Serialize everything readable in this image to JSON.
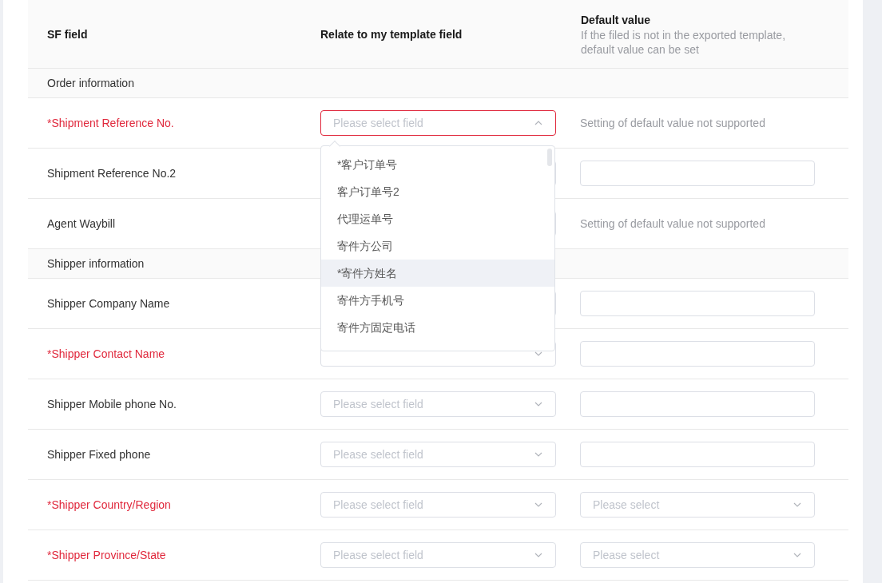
{
  "header": {
    "columns": [
      {
        "title": "SF field"
      },
      {
        "title": "Relate to my template field"
      },
      {
        "title": "Default value",
        "hint": "If the filed is not in the exported template, default value can be set"
      }
    ]
  },
  "rows": [
    {
      "kind": "section",
      "label": "Order information"
    },
    {
      "kind": "field",
      "label": "*Shipment Reference No.",
      "required": true,
      "mapping": {
        "placeholder": "Please select field",
        "open": true
      },
      "default": {
        "kind": "note",
        "text": "Setting of default value not supported"
      }
    },
    {
      "kind": "field",
      "label": "Shipment Reference No.2",
      "required": false,
      "mapping": {
        "open": false
      },
      "default": {
        "kind": "input"
      }
    },
    {
      "kind": "field",
      "label": "Agent Waybill",
      "required": false,
      "mapping": {
        "open": false
      },
      "default": {
        "kind": "note",
        "text": "Setting of default value not supported"
      }
    },
    {
      "kind": "section",
      "label": "Shipper information"
    },
    {
      "kind": "field",
      "label": "Shipper Company Name",
      "required": false,
      "mapping": {
        "open": false
      },
      "default": {
        "kind": "input"
      }
    },
    {
      "kind": "field",
      "label": "*Shipper Contact Name",
      "required": true,
      "mapping": {
        "open": false
      },
      "default": {
        "kind": "input"
      }
    },
    {
      "kind": "field",
      "label": "Shipper Mobile phone No.",
      "required": false,
      "mapping": {
        "placeholder": "Please select field",
        "open": false
      },
      "default": {
        "kind": "input"
      }
    },
    {
      "kind": "field",
      "label": "Shipper Fixed phone",
      "required": false,
      "mapping": {
        "placeholder": "Please select field",
        "open": false
      },
      "default": {
        "kind": "input"
      }
    },
    {
      "kind": "field",
      "label": "*Shipper Country/Region",
      "required": true,
      "mapping": {
        "placeholder": "Please select field",
        "open": false
      },
      "default": {
        "kind": "select",
        "placeholder": "Please select"
      }
    },
    {
      "kind": "field",
      "label": "*Shipper Province/State",
      "required": true,
      "mapping": {
        "placeholder": "Please select field",
        "open": false
      },
      "default": {
        "kind": "select",
        "placeholder": "Please select"
      }
    }
  ],
  "dropdown": {
    "options": [
      {
        "label": "*客户订单号",
        "hovered": false
      },
      {
        "label": "客户订单号2",
        "hovered": false
      },
      {
        "label": "代理运单号",
        "hovered": false
      },
      {
        "label": "寄件方公司",
        "hovered": false
      },
      {
        "label": "*寄件方姓名",
        "hovered": true
      },
      {
        "label": "寄件方手机号",
        "hovered": false
      },
      {
        "label": "寄件方固定电话",
        "hovered": false
      }
    ]
  }
}
